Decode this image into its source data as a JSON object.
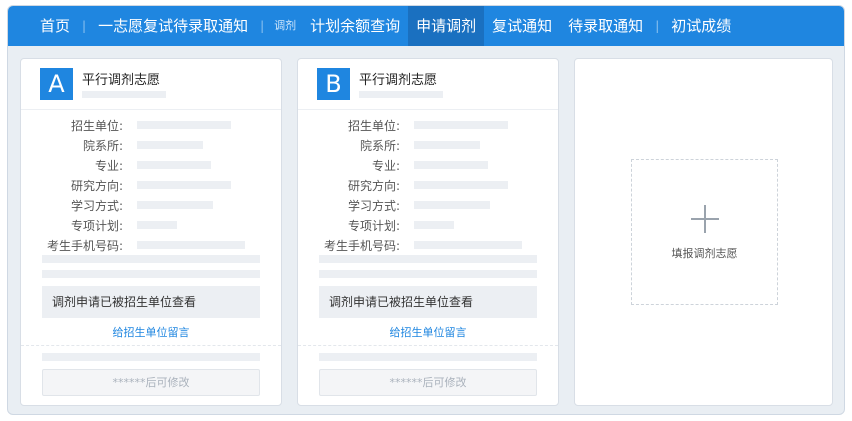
{
  "nav": {
    "items": [
      {
        "label": "首页"
      },
      {
        "label": "一志愿复试待录取通知"
      },
      {
        "label": "调剂"
      },
      {
        "label": "计划余额查询"
      },
      {
        "label": "申请调剂"
      },
      {
        "label": "复试通知"
      },
      {
        "label": "待录取通知"
      },
      {
        "label": "初试成绩"
      }
    ],
    "separator": "|"
  },
  "cards": [
    {
      "badge": "A",
      "title": "平行调剂志愿",
      "fields": [
        "招生单位:",
        "院系所:",
        "专业:",
        "研究方向:",
        "学习方式:",
        "专项计划:",
        "考生手机号码:"
      ],
      "notice": "调剂申请已被招生单位查看",
      "message_link": "给招生单位留言",
      "edit_button": "******后可修改"
    },
    {
      "badge": "B",
      "title": "平行调剂志愿",
      "fields": [
        "招生单位:",
        "院系所:",
        "专业:",
        "研究方向:",
        "学习方式:",
        "专项计划:",
        "考生手机号码:"
      ],
      "notice": "调剂申请已被招生单位查看",
      "message_link": "给招生单位留言",
      "edit_button": "******后可修改"
    }
  ],
  "add_card": {
    "icon": "plus-icon",
    "label": "填报调剂志愿"
  },
  "colors": {
    "accent": "#1f86e0",
    "nav_active": "#1a70c0",
    "placeholder": "#eceff3"
  }
}
